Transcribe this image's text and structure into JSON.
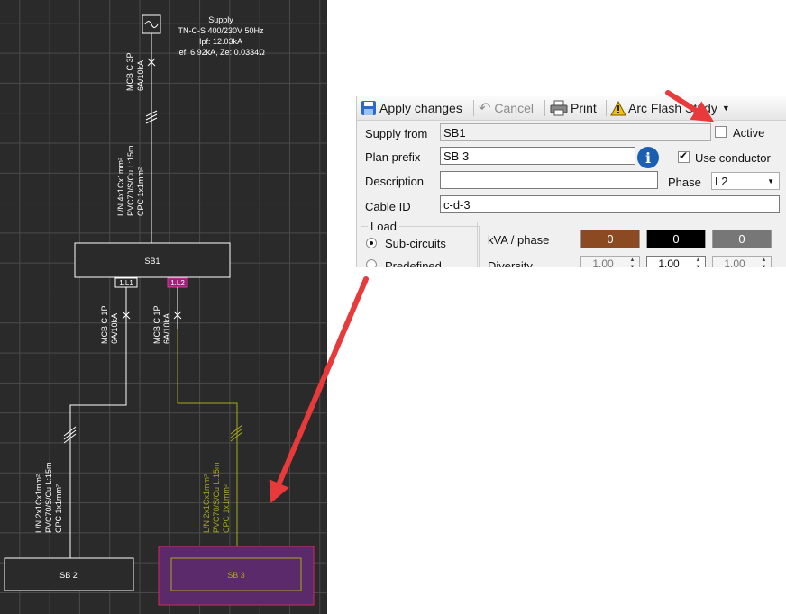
{
  "diagram": {
    "supply": {
      "title": "Supply",
      "line1": "TN-C-S 400/230V 50Hz",
      "line2": "Ipf: 12.03kA",
      "line3": "Ief: 6.92kA, Ze: 0.0334Ω"
    },
    "main_breaker": {
      "line1": "MCB C 3P",
      "line2": "6A/10kA"
    },
    "main_cable": {
      "line1": "L/N 4x1Cx1mm²",
      "line2": "PVC70/S/Cu L:15m",
      "line3": "CPC 1x1mm²"
    },
    "board_sb1": "SB1",
    "tag_l1": "1.L1",
    "tag_l2": "1.L2",
    "breaker_left": {
      "line1": "MCB C 1P",
      "line2": "6A/10kA"
    },
    "breaker_right": {
      "line1": "MCB C 1P",
      "line2": "6A/10kA"
    },
    "cable_left": {
      "line1": "L/N 2x1Cx1mm²",
      "line2": "PVC70/S/Cu L:15m",
      "line3": "CPC 1x1mm²"
    },
    "cable_right": {
      "line1": "L/N 2x1Cx1mm²",
      "line2": "PVC70/S/Cu L:15m",
      "line3": "CPC 1x1mm²"
    },
    "board_sb2": "SB 2",
    "board_sb3": "SB 3"
  },
  "toolbar": {
    "apply_label": "Apply changes",
    "cancel_label": "Cancel",
    "print_label": "Print",
    "arcflash_label": "Arc Flash Study"
  },
  "form": {
    "supply_from_label": "Supply from",
    "supply_from_value": "SB1",
    "active_label": "Active",
    "active_checked": false,
    "plan_prefix_label": "Plan prefix",
    "plan_prefix_value": "SB 3",
    "use_conductor_label": "Use conductor",
    "use_conductor_checked": true,
    "description_label": "Description",
    "description_value": "",
    "phase_label": "Phase",
    "phase_value": "L2",
    "cable_id_label": "Cable ID",
    "cable_id_value": "c-d-3",
    "load_group_label": "Load",
    "subcircuits_label": "Sub-circuits",
    "predefined_label": "Predefined",
    "kva_phase_label": "kVA / phase",
    "kva_values": [
      "0",
      "0",
      "0"
    ],
    "diversity_label": "Diversity",
    "diversity_values": [
      "1.00",
      "1.00",
      "1.00"
    ]
  },
  "colors": {
    "phase_l1": "#8b4a22",
    "phase_l2": "#000000",
    "phase_l3": "#777777",
    "highlight_arrow": "#e8393b",
    "selected_cable": "#a8a820",
    "selected_board_fill": "#5a2a6a",
    "tag_l2_bg": "#a0207a"
  }
}
